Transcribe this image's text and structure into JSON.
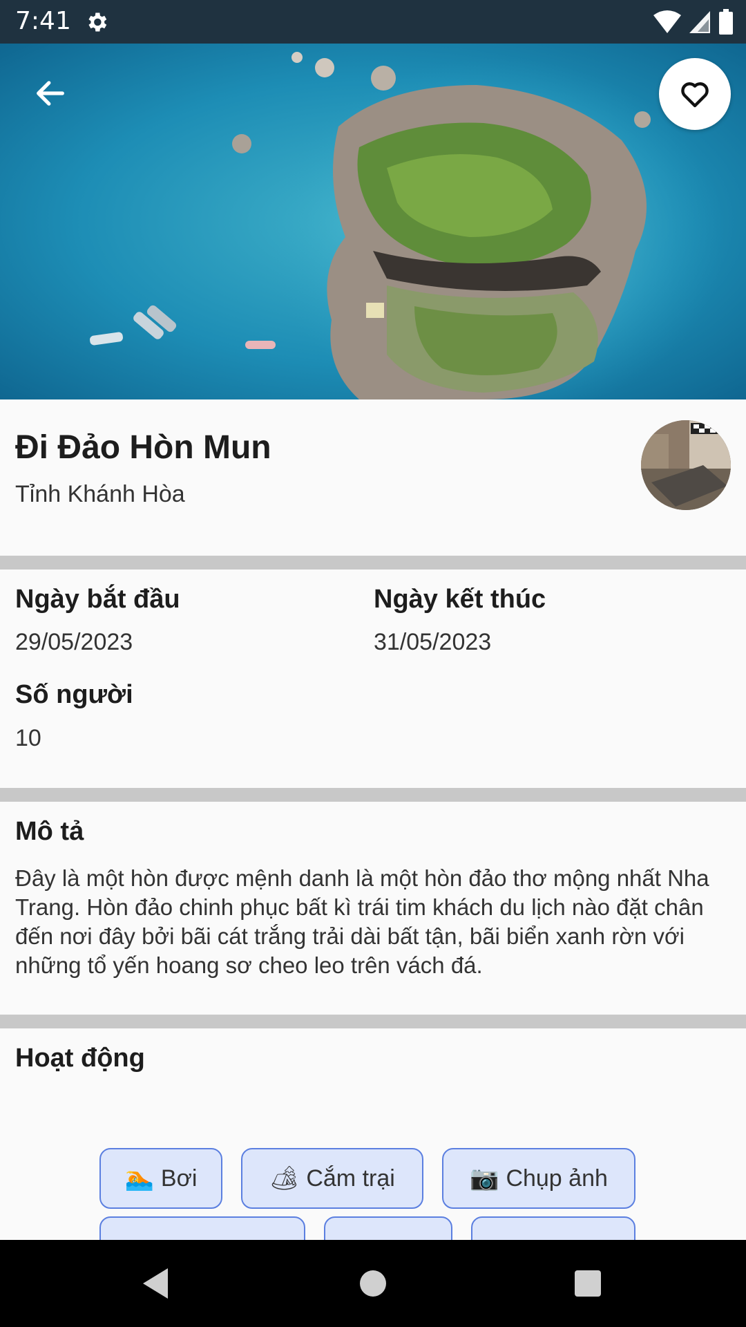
{
  "status_bar": {
    "time": "7:41",
    "icons": [
      "settings-icon",
      "wifi-icon",
      "signal-icon",
      "battery-icon"
    ]
  },
  "hero": {
    "icons": {
      "back": "arrow-left-icon",
      "favorite": "heart-outline-icon"
    }
  },
  "trip": {
    "title": "Đi Đảo Hòn Mun",
    "location": "Tỉnh Khánh Hòa"
  },
  "details": {
    "start_label": "Ngày bắt đầu",
    "start_value": "29/05/2023",
    "end_label": "Ngày kết thúc",
    "end_value": "31/05/2023",
    "people_label": "Số người",
    "people_value": "10"
  },
  "description": {
    "title": "Mô tả",
    "text": "Đây là một hòn được mệnh danh là một hòn đảo thơ mộng nhất Nha Trang. Hòn đảo chinh phục bất kì trái tim khách du lịch nào đặt chân đến nơi đây bởi bãi cát trắng trải dài bất tận, bãi biển xanh rờn với những tổ yến hoang sơ cheo leo trên vách đá."
  },
  "activities": {
    "title": "Hoạt động",
    "chips": [
      {
        "emoji": "🏊",
        "label": "Bơi"
      },
      {
        "emoji": "🏕",
        "label": "Cắm trại"
      },
      {
        "emoji": "📷",
        "label": "Chụp ảnh"
      }
    ]
  },
  "colors": {
    "chip_bg": "#dde6fb",
    "chip_border": "#5b7fe0",
    "divider": "#c8c8c8",
    "status_bar": "#1f3240"
  },
  "nav": {
    "icons": [
      "back-triangle-icon",
      "home-circle-icon",
      "recents-square-icon"
    ]
  }
}
